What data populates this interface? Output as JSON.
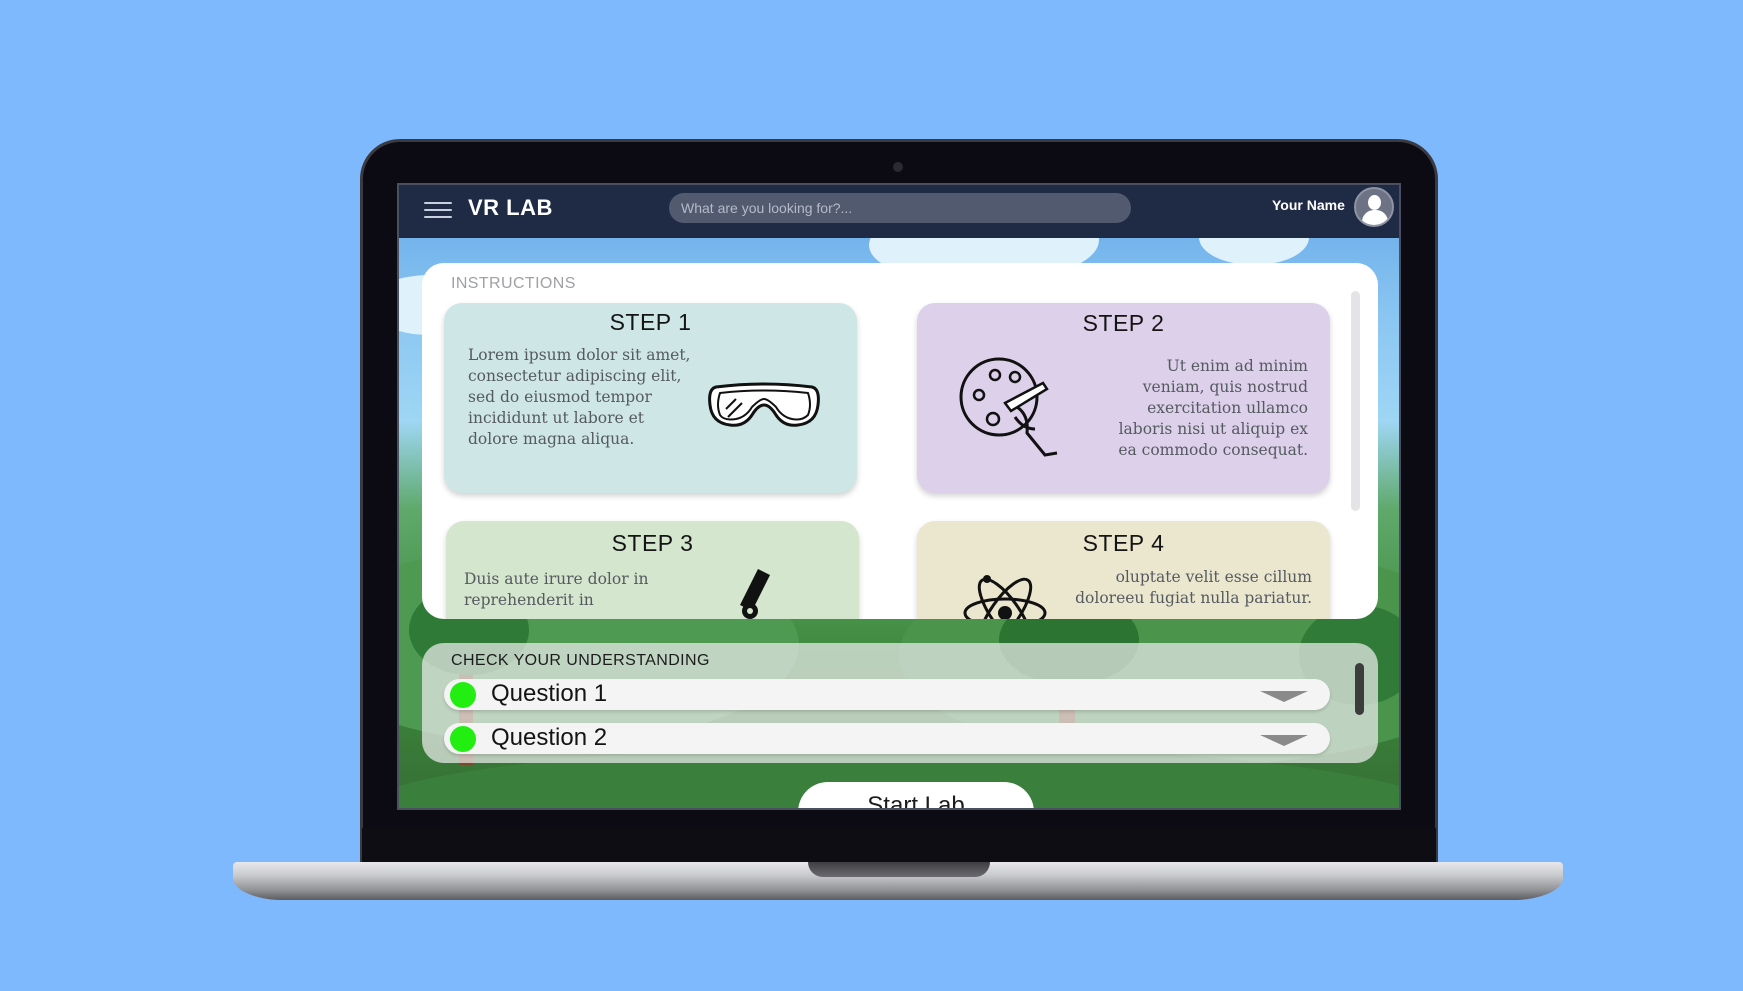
{
  "app": {
    "title": "VR LAB"
  },
  "search": {
    "placeholder": "What are you looking for?..."
  },
  "user": {
    "name": "Your Name"
  },
  "instructions": {
    "label": "INSTRUCTIONS",
    "steps": [
      {
        "title": "STEP 1",
        "text": "Lorem ipsum dolor sit amet, consectetur adipiscing elit, sed do eiusmod tempor incididunt ut labore et dolore magna aliqua.",
        "icon": "safety-goggles-icon",
        "color": "#cfe6e6"
      },
      {
        "title": "STEP 2",
        "text": "Ut enim ad minim veniam, quis nostrud exercitation ullamco laboris nisi ut aliquip ex ea commodo consequat.",
        "icon": "paint-palette-icon",
        "color": "#ddd0ea"
      },
      {
        "title": "STEP 3",
        "text": "Duis aute irure dolor in reprehenderit in",
        "icon": "microscope-icon",
        "color": "#d5e6cf"
      },
      {
        "title": "STEP 4",
        "text": "oluptate velit esse cillum doloreeu fugiat nulla pariatur.",
        "icon": "atom-icon",
        "color": "#ebe7cf"
      }
    ]
  },
  "check": {
    "label": "CHECK YOUR UNDERSTANDING",
    "questions": [
      {
        "label": "Question 1",
        "status_color": "#22ee11"
      },
      {
        "label": "Question 2",
        "status_color": "#22ee11"
      }
    ]
  },
  "actions": {
    "start_label": "Start Lab"
  }
}
